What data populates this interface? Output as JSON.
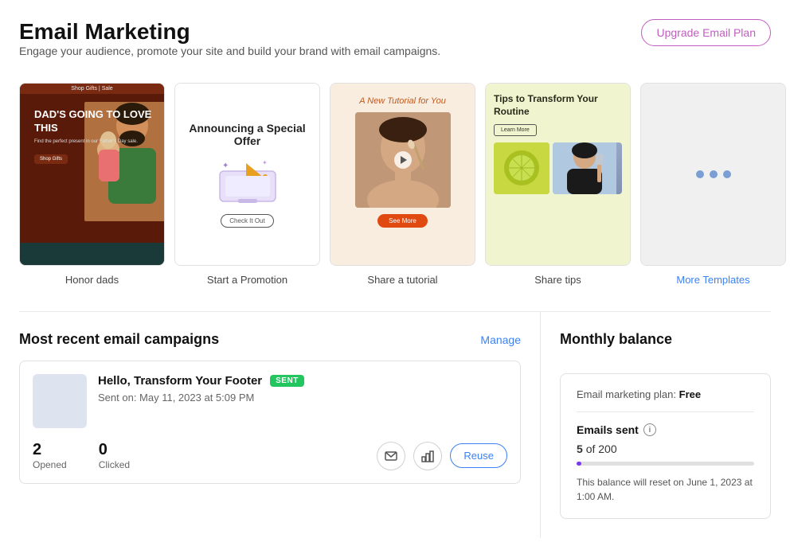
{
  "header": {
    "title": "Email Marketing",
    "subtitle": "Engage your audience, promote your site and build your brand with email campaigns.",
    "upgrade_button": "Upgrade Email Plan"
  },
  "templates": [
    {
      "id": "honor-dads",
      "label": "Honor dads",
      "top_bar": "Shop Gifts | Sale",
      "headline": "DAD'S GOING TO LOVE THIS",
      "sub": "Find the perfect present in our Father's Day sale.",
      "btn": "Shop Gifts"
    },
    {
      "id": "start-promotion",
      "label": "Start a Promotion",
      "headline": "Announcing a Special Offer",
      "btn": "Check It Out"
    },
    {
      "id": "share-tutorial",
      "label": "Share a tutorial",
      "title": "A New Tutorial for You",
      "btn": "See More"
    },
    {
      "id": "share-tips",
      "label": "Share tips",
      "title": "Tips to Transform Your Routine",
      "learn_btn": "Learn More"
    },
    {
      "id": "more-templates",
      "label": "More Templates",
      "is_link": true
    }
  ],
  "campaigns": {
    "section_title": "Most recent email campaigns",
    "manage_label": "Manage",
    "items": [
      {
        "name": "Hello, Transform Your Footer",
        "status": "SENT",
        "date": "Sent on: May 11, 2023 at 5:09 PM",
        "opened": "2",
        "opened_label": "Opened",
        "clicked": "0",
        "clicked_label": "Clicked",
        "reuse_label": "Reuse"
      }
    ]
  },
  "balance": {
    "section_title": "Monthly balance",
    "plan_text": "Email marketing plan:",
    "plan_name": "Free",
    "emails_sent_label": "Emails sent",
    "count": "5",
    "count_of": "of 200",
    "progress_pct": 2.5,
    "reset_text": "This balance will reset on June 1, 2023 at 1:00 AM.",
    "info_icon_label": "i"
  },
  "icons": {
    "envelope": "✉",
    "chart": "📊"
  }
}
